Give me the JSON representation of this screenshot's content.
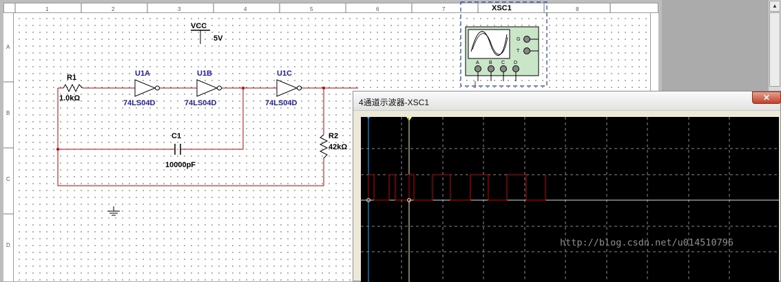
{
  "ruler": {
    "top_ticks": [
      "1",
      "2",
      "3",
      "4",
      "5",
      "6",
      "7",
      "8"
    ],
    "left_ticks": [
      "A",
      "B",
      "C",
      "D"
    ]
  },
  "schematic": {
    "vcc": {
      "label": "VCC",
      "voltage": "5V"
    },
    "r1": {
      "ref": "R1",
      "value": "1.0kΩ"
    },
    "u1a": {
      "ref": "U1A",
      "part": "74LS04D"
    },
    "u1b": {
      "ref": "U1B",
      "part": "74LS04D"
    },
    "u1c": {
      "ref": "U1C",
      "part": "74LS04D"
    },
    "c1": {
      "ref": "C1",
      "value": "10000pF"
    },
    "r2": {
      "ref": "R2",
      "value": "42kΩ"
    },
    "xsc1": {
      "ref": "XSC1",
      "terminals_right": [
        "G",
        "T"
      ],
      "terminals_bottom": [
        "A",
        "B",
        "C",
        "D"
      ]
    },
    "colors": {
      "wire": "#cc0000",
      "label": "#1f1fb0",
      "text": "#000000"
    }
  },
  "scope_window": {
    "title": "4通道示波器-XSC1",
    "close_icon": "close-icon",
    "grid_divisions": {
      "x": 10,
      "y": 6
    },
    "trace_color": "#cc0000",
    "cursor1_color": "#2aa8ff",
    "cursor2_color": "#ffff66",
    "cursor_labels": [
      "1",
      "2"
    ],
    "watermark": "http://blog.csdn.net/u014510796"
  }
}
